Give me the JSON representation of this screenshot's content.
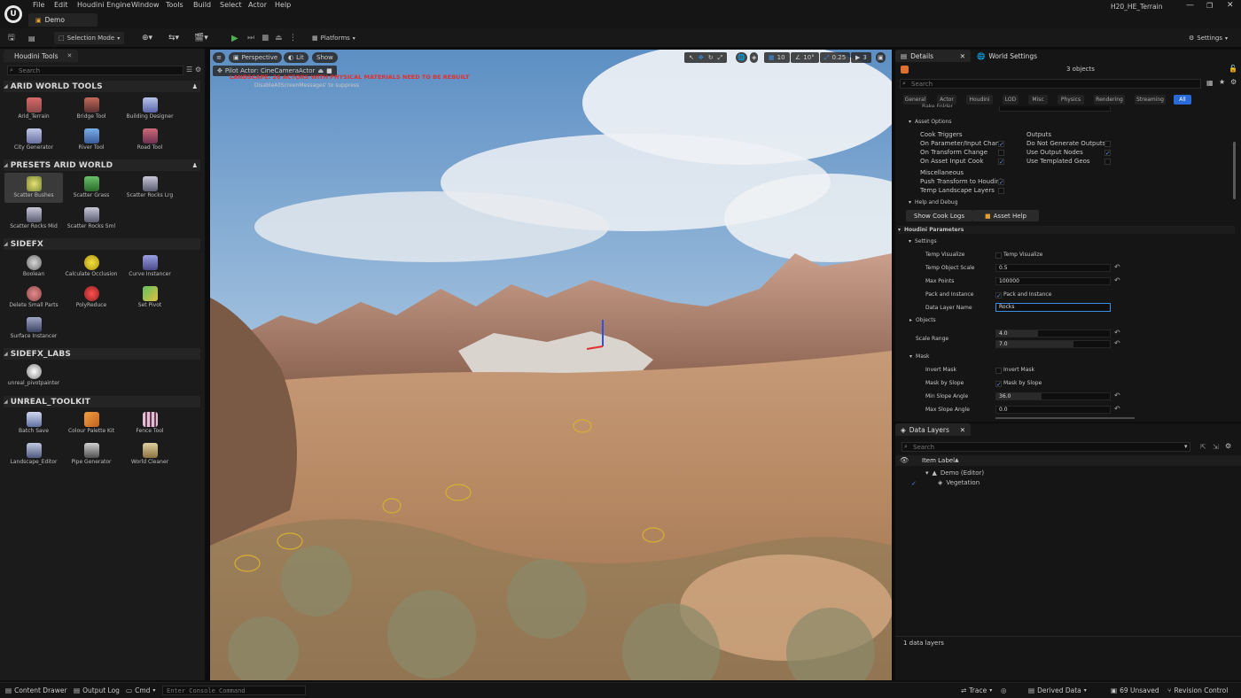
{
  "app": {
    "project": "H20_HE_Terrain",
    "level_tab": "Demo"
  },
  "menu": [
    "File",
    "Edit",
    "Houdini Engine",
    "Window",
    "Tools",
    "Build",
    "Select",
    "Actor",
    "Help"
  ],
  "toolbar": {
    "mode": "Selection Mode",
    "platforms": "Platforms",
    "settings": "Settings"
  },
  "left_panel": {
    "tab": "Houdini Tools",
    "search_placeholder": "Search",
    "categories": [
      {
        "title": "ARID WORLD TOOLS",
        "items": [
          "Arid_Terrain",
          "Bridge Tool",
          "Building Designer",
          "City Generator",
          "River Tool",
          "Road Tool"
        ]
      },
      {
        "title": "PRESETS ARID WORLD",
        "items": [
          "Scatter Bushes",
          "Scatter Grass",
          "Scatter Rocks Lrg",
          "Scatter Rocks Mid",
          "Scatter Rocks Sml"
        ]
      },
      {
        "title": "SIDEFX",
        "items": [
          "Boolean",
          "Calculate Occlusion",
          "Curve Instancer",
          "Delete Small Parts",
          "PolyReduce",
          "Set Pivot",
          "Surface Instancer"
        ]
      },
      {
        "title": "SIDEFX_LABS",
        "items": [
          "unreal_pivotpainter"
        ]
      },
      {
        "title": "UNREAL_TOOLKIT",
        "items": [
          "Batch Save",
          "Colour Palette Kit",
          "Fence Tool",
          "Landscape_Editor",
          "Pipe Generator",
          "World Cleaner"
        ]
      }
    ],
    "selected_item": "Scatter Bushes"
  },
  "viewport": {
    "perspective": "Perspective",
    "lit": "Lit",
    "show": "Show",
    "pilot": "Pilot Actor: CineCameraActor",
    "warning": "LANDSCAPE: 26 ACTORS WITH PHYSICAL MATERIALS NEED TO BE REBUILT",
    "warning_sub": "DisableAllScreenMessages' to suppress",
    "grid": "10",
    "rotation": "10°",
    "scale": "0.25",
    "camera_speed": "3"
  },
  "details": {
    "tab": "Details",
    "tab2": "World Settings",
    "objects": "3 objects",
    "search_placeholder": "Search",
    "filter_tabs": [
      "General",
      "Actor",
      "Houdini",
      "LOD",
      "Misc",
      "Physics",
      "Rendering",
      "Streaming",
      "All"
    ],
    "bake_folder": "Bake Folder",
    "asset_options": "Asset Options",
    "cook_triggers": "Cook Triggers",
    "outputs": "Outputs",
    "on_param": "On Parameter/Input Chang",
    "on_transform": "On Transform Change",
    "on_asset_input": "On Asset Input Cook",
    "do_not_generate": "Do Not Generate Outputs",
    "use_output_nodes": "Use Output Nodes",
    "use_templated": "Use Templated Geos",
    "misc": "Miscellaneous",
    "push_transform": "Push Transform to Houdini",
    "temp_landscape": "Temp Landscape Layers",
    "help_debug": "Help and Debug",
    "show_cook_logs": "Show Cook Logs",
    "asset_help": "Asset Help",
    "houdini_params": "Houdini Parameters",
    "settings": "Settings",
    "temp_visualize": "Temp Visualize",
    "temp_visualize_value": "Temp Visualize",
    "temp_object_scale": "Temp Object Scale",
    "temp_object_scale_value": "0.5",
    "max_points": "Max Points",
    "max_points_value": "100000",
    "pack_instance": "Pack and Instance",
    "pack_instance_value": "Pack and Instance",
    "data_layer_name": "Data Layer Name",
    "data_layer_name_value": "Rocks",
    "objects_label": "Objects",
    "scale_range": "Scale Range",
    "scale_min": "4.0",
    "scale_max": "7.0",
    "mask": "Mask",
    "invert_mask": "Invert Mask",
    "invert_mask_value": "Invert Mask",
    "mask_by_slope": "Mask by Slope",
    "mask_by_slope_value": "Mask by Slope",
    "min_slope": "Min Slope Angle",
    "min_slope_value": "36.0",
    "max_slope": "Max Slope Angle",
    "max_slope_value": "0.0"
  },
  "data_layers": {
    "tab": "Data Layers",
    "search_placeholder": "Search",
    "column": "Item Label",
    "root": "Demo (Editor)",
    "child": "Vegetation",
    "count": "1 data layers"
  },
  "statusbar": {
    "content_drawer": "Content Drawer",
    "output_log": "Output Log",
    "cmd": "Cmd",
    "console_placeholder": "Enter Console Command",
    "trace": "Trace",
    "derived_data": "Derived Data",
    "unsaved": "69 Unsaved",
    "revision": "Revision Control"
  },
  "colors": {
    "accent": "#3a8ee6",
    "panel": "#151515",
    "warning_red": "#e03030"
  }
}
